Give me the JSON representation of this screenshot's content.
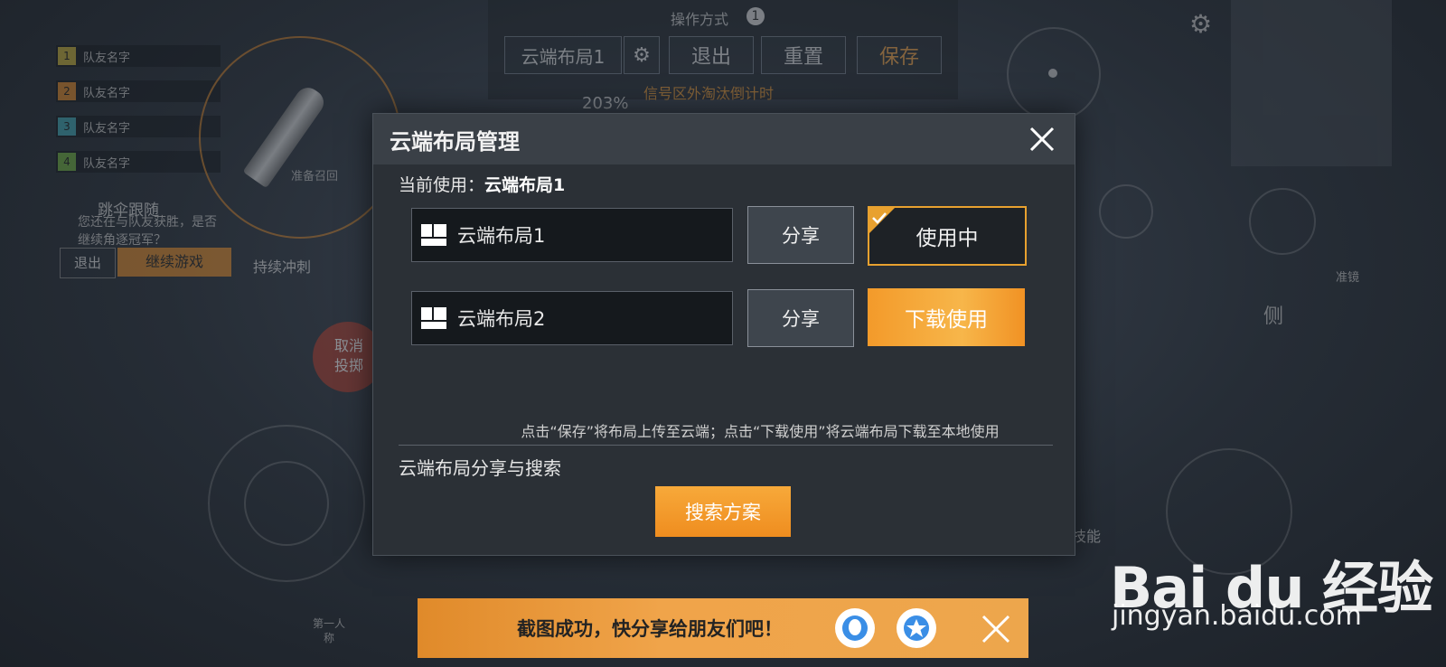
{
  "hud": {
    "mode_label": "操作方式",
    "mode_badge": "1",
    "layout_name": "云端布局1",
    "exit": "退出",
    "reset": "重置",
    "save": "保存",
    "countdown_text": "信号区外淘汰倒计时",
    "percent": "203%",
    "team": [
      {
        "num": "1",
        "name": "队友名字",
        "color": "#c9b23a"
      },
      {
        "num": "2",
        "name": "队友名字",
        "color": "#e08a2a"
      },
      {
        "num": "3",
        "name": "队友名字",
        "color": "#3fa7b5"
      },
      {
        "num": "4",
        "name": "队友名字",
        "color": "#6fb03f"
      }
    ],
    "follow_label": "跳伞跟随",
    "prompt_text": "您还在与队友获胜，是否继续角逐冠军？",
    "prompt_exit": "退出",
    "prompt_continue": "继续游戏",
    "sprint_label": "持续冲刺",
    "recall_label": "准备召回",
    "cancel_throw": "取消投掷",
    "scope_label": "准镜",
    "side_label": "侧",
    "skill_label": "技能",
    "first_person": "第一人称"
  },
  "modal": {
    "title": "云端布局管理",
    "current_prefix": "当前使用：",
    "current_value": "云端布局1",
    "layouts": [
      {
        "name": "云端布局1",
        "share": "分享",
        "action": "使用中"
      },
      {
        "name": "云端布局2",
        "share": "分享",
        "action": "下载使用"
      }
    ],
    "hint": "点击“保存”将布局上传至云端；点击“下载使用”将云端布局下载至本地使用",
    "section": "云端布局分享与搜索",
    "search_button": "搜索方案"
  },
  "toast": {
    "text": "截图成功，快分享给朋友们吧！"
  },
  "watermark": {
    "logo": "Bai du 经验",
    "url": "jingyan.baidu.com"
  },
  "colors": {
    "accent_orange": "#f39a2a",
    "panel": "#2b3036"
  }
}
